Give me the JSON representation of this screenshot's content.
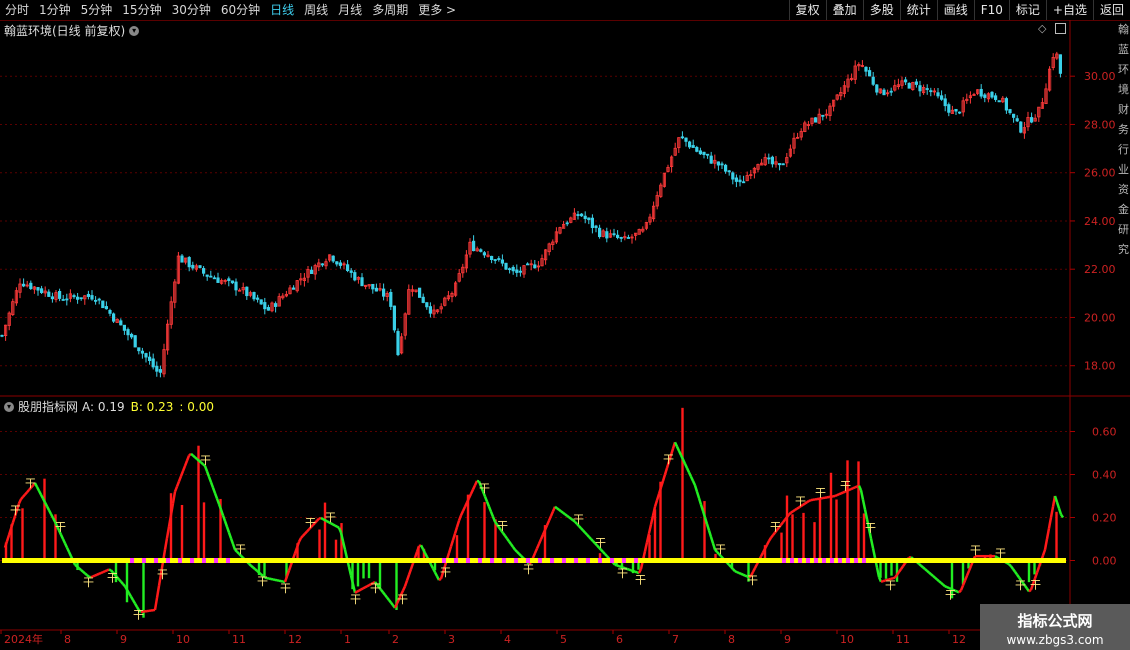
{
  "toolbar": {
    "periods": [
      "分时",
      "1分钟",
      "5分钟",
      "15分钟",
      "30分钟",
      "60分钟",
      "日线",
      "周线",
      "月线",
      "多周期",
      "更多 >"
    ],
    "active_period": "日线",
    "actions": [
      "复权",
      "叠加",
      "多股",
      "统计",
      "画线",
      "F10",
      "标记",
      "+自选",
      "返回"
    ]
  },
  "price_panel": {
    "title": "翰蓝环境(日线 前复权)",
    "y_ticks": [
      "30.00",
      "28.00",
      "26.00",
      "24.00",
      "22.00",
      "20.00",
      "18.00"
    ]
  },
  "indicator_panel": {
    "name": "股朋指标网",
    "a_label": "A: 0.19",
    "b_label": "B: 0.23",
    "c_label": ": 0.00",
    "y_ticks": [
      "0.60",
      "0.40",
      "0.20",
      "0.00"
    ]
  },
  "date_axis": [
    "2024年",
    "8",
    "9",
    "10",
    "11",
    "12",
    "1",
    "2",
    "3",
    "4",
    "5",
    "6",
    "7",
    "8",
    "9",
    "10",
    "11",
    "12",
    "1"
  ],
  "side_strip_text": "翰蓝环境财务行业资金研究",
  "watermark": {
    "line1": "指标公式网",
    "line2": "www.zbgs3.com"
  },
  "colors": {
    "up": "#ff3a3a",
    "down": "#3ad0e8",
    "ind_up": "#ff1a1a",
    "ind_down": "#22ee22",
    "zero_line": "#ffff00",
    "zero_dots": "#ff33ff"
  },
  "chart_data": [
    {
      "type": "candlestick",
      "title": "翰蓝环境(日线 前复权)",
      "ylim": [
        17.2,
        31.5
      ],
      "price_path": [
        [
          0,
          19.0
        ],
        [
          20,
          21.5
        ],
        [
          60,
          20.8
        ],
        [
          95,
          20.9
        ],
        [
          130,
          19.2
        ],
        [
          160,
          17.6
        ],
        [
          178,
          22.5
        ],
        [
          205,
          21.8
        ],
        [
          240,
          21.2
        ],
        [
          268,
          20.3
        ],
        [
          300,
          21.6
        ],
        [
          330,
          22.6
        ],
        [
          360,
          21.5
        ],
        [
          390,
          20.8
        ],
        [
          398,
          18.5
        ],
        [
          410,
          21.4
        ],
        [
          435,
          20.1
        ],
        [
          455,
          21.2
        ],
        [
          470,
          23.0
        ],
        [
          490,
          22.6
        ],
        [
          515,
          21.8
        ],
        [
          540,
          22.3
        ],
        [
          560,
          23.8
        ],
        [
          580,
          24.3
        ],
        [
          600,
          23.5
        ],
        [
          625,
          23.2
        ],
        [
          645,
          23.6
        ],
        [
          660,
          25.5
        ],
        [
          680,
          27.5
        ],
        [
          700,
          26.8
        ],
        [
          720,
          26.3
        ],
        [
          740,
          25.5
        ],
        [
          760,
          26.6
        ],
        [
          780,
          26.2
        ],
        [
          800,
          27.8
        ],
        [
          830,
          28.6
        ],
        [
          860,
          30.6
        ],
        [
          880,
          29.3
        ],
        [
          905,
          29.7
        ],
        [
          930,
          29.4
        ],
        [
          955,
          28.4
        ],
        [
          975,
          29.4
        ],
        [
          1000,
          29.1
        ],
        [
          1020,
          27.8
        ],
        [
          1040,
          28.6
        ],
        [
          1055,
          31.2
        ],
        [
          1062,
          29.8
        ]
      ]
    },
    {
      "type": "line",
      "title": "股朋指标网",
      "ylim": [
        -0.3,
        0.7
      ],
      "series_a_path": [
        [
          5,
          0.06
        ],
        [
          20,
          0.28
        ],
        [
          35,
          0.36
        ],
        [
          55,
          0.18
        ],
        [
          75,
          -0.02
        ],
        [
          90,
          -0.08
        ],
        [
          110,
          -0.04
        ],
        [
          125,
          -0.12
        ],
        [
          140,
          -0.24
        ],
        [
          155,
          -0.23
        ],
        [
          165,
          0.05
        ],
        [
          175,
          0.32
        ],
        [
          190,
          0.5
        ],
        [
          205,
          0.44
        ],
        [
          220,
          0.25
        ],
        [
          235,
          0.05
        ],
        [
          250,
          -0.02
        ],
        [
          265,
          -0.08
        ],
        [
          285,
          -0.1
        ],
        [
          300,
          0.1
        ],
        [
          320,
          0.2
        ],
        [
          340,
          0.15
        ],
        [
          355,
          -0.15
        ],
        [
          375,
          -0.1
        ],
        [
          395,
          -0.22
        ],
        [
          405,
          -0.12
        ],
        [
          420,
          0.08
        ],
        [
          440,
          -0.1
        ],
        [
          460,
          0.2
        ],
        [
          478,
          0.38
        ],
        [
          495,
          0.18
        ],
        [
          515,
          0.05
        ],
        [
          530,
          -0.02
        ],
        [
          555,
          0.25
        ],
        [
          575,
          0.18
        ],
        [
          595,
          0.08
        ],
        [
          615,
          -0.02
        ],
        [
          640,
          -0.06
        ],
        [
          655,
          0.25
        ],
        [
          675,
          0.55
        ],
        [
          695,
          0.35
        ],
        [
          715,
          0.05
        ],
        [
          735,
          -0.05
        ],
        [
          750,
          -0.08
        ],
        [
          770,
          0.1
        ],
        [
          790,
          0.22
        ],
        [
          810,
          0.28
        ],
        [
          835,
          0.3
        ],
        [
          860,
          0.35
        ],
        [
          880,
          -0.1
        ],
        [
          895,
          -0.08
        ],
        [
          910,
          0.02
        ],
        [
          925,
          -0.04
        ],
        [
          945,
          -0.12
        ],
        [
          960,
          -0.15
        ],
        [
          975,
          0.02
        ],
        [
          995,
          0.02
        ],
        [
          1010,
          -0.02
        ],
        [
          1030,
          -0.15
        ],
        [
          1045,
          0.05
        ],
        [
          1055,
          0.3
        ],
        [
          1062,
          0.2
        ]
      ],
      "marker_x": [
        15,
        30,
        60,
        88,
        112,
        138,
        162,
        205,
        240,
        262,
        285,
        310,
        330,
        355,
        375,
        402,
        445,
        484,
        502,
        528,
        578,
        600,
        622,
        640,
        668,
        720,
        752,
        775,
        800,
        820,
        845,
        870,
        890,
        950,
        975,
        1000,
        1020,
        1035
      ]
    }
  ]
}
